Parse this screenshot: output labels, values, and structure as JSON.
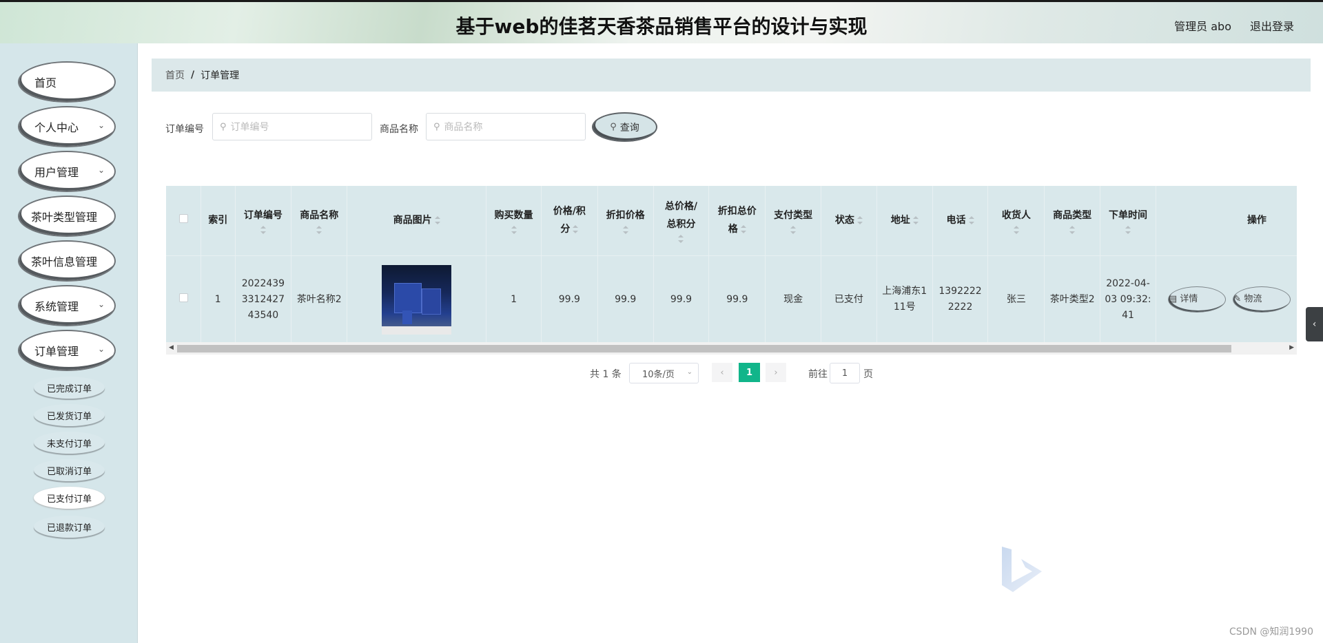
{
  "header": {
    "title": "基于web的佳茗天香茶品销售平台的设计与实现",
    "user_label": "管理员 abo",
    "logout_label": "退出登录"
  },
  "sidebar": {
    "items": [
      {
        "label": "首页",
        "has_arrow": false
      },
      {
        "label": "个人中心",
        "has_arrow": true
      },
      {
        "label": "用户管理",
        "has_arrow": true
      },
      {
        "label": "茶叶类型管理",
        "has_arrow": false
      },
      {
        "label": "茶叶信息管理",
        "has_arrow": false
      },
      {
        "label": "系统管理",
        "has_arrow": true
      },
      {
        "label": "订单管理",
        "has_arrow": true
      }
    ],
    "subitems": [
      {
        "label": "已完成订单",
        "active": false
      },
      {
        "label": "已发货订单",
        "active": false
      },
      {
        "label": "未支付订单",
        "active": false
      },
      {
        "label": "已取消订单",
        "active": false
      },
      {
        "label": "已支付订单",
        "active": true
      },
      {
        "label": "已退款订单",
        "active": false
      }
    ]
  },
  "breadcrumb": {
    "home": "首页",
    "separator": "/",
    "current": "订单管理"
  },
  "search": {
    "order_no_label": "订单编号",
    "order_no_placeholder": "订单编号",
    "product_name_label": "商品名称",
    "product_name_placeholder": "商品名称",
    "query_label": "查询"
  },
  "table": {
    "columns": [
      {
        "key": "index",
        "label": "索引"
      },
      {
        "key": "order_no",
        "label": "订单编号"
      },
      {
        "key": "product_name",
        "label": "商品名称"
      },
      {
        "key": "product_image",
        "label": "商品图片"
      },
      {
        "key": "quantity",
        "label": "购买数量"
      },
      {
        "key": "price",
        "label": "价格/积分"
      },
      {
        "key": "discount_price",
        "label": "折扣价格"
      },
      {
        "key": "total_price",
        "label": "总价格/总积分"
      },
      {
        "key": "discount_total",
        "label": "折扣总价格"
      },
      {
        "key": "pay_type",
        "label": "支付类型"
      },
      {
        "key": "status",
        "label": "状态"
      },
      {
        "key": "address",
        "label": "地址"
      },
      {
        "key": "phone",
        "label": "电话"
      },
      {
        "key": "receiver",
        "label": "收货人"
      },
      {
        "key": "product_type",
        "label": "商品类型"
      },
      {
        "key": "order_time",
        "label": "下单时间"
      },
      {
        "key": "actions",
        "label": "操作"
      }
    ],
    "rows": [
      {
        "index": "1",
        "order_no": "2022439331242743540",
        "product_name": "茶叶名称2",
        "product_image": "tea-gift-box-image",
        "quantity": "1",
        "price": "99.9",
        "discount_price": "99.9",
        "total_price": "99.9",
        "discount_total": "99.9",
        "pay_type": "现金",
        "status": "已支付",
        "address": "上海浦东111号",
        "phone": "13922222222",
        "receiver": "张三",
        "product_type": "茶叶类型2",
        "order_time": "2022-04-03 09:32:41",
        "actions": [
          "详情",
          "物流"
        ]
      }
    ]
  },
  "pagination": {
    "total_label": "共 1 条",
    "page_size": "10条/页",
    "current_page": "1",
    "goto_label": "前往",
    "goto_value": "1",
    "page_unit": "页"
  },
  "watermark": "CSDN @知润1990",
  "colors": {
    "accent": "#11b58a",
    "sidebar_bg": "#d5e6ea",
    "table_bg": "#d9e8eb",
    "breadcrumb_bg": "#dce8ea"
  }
}
